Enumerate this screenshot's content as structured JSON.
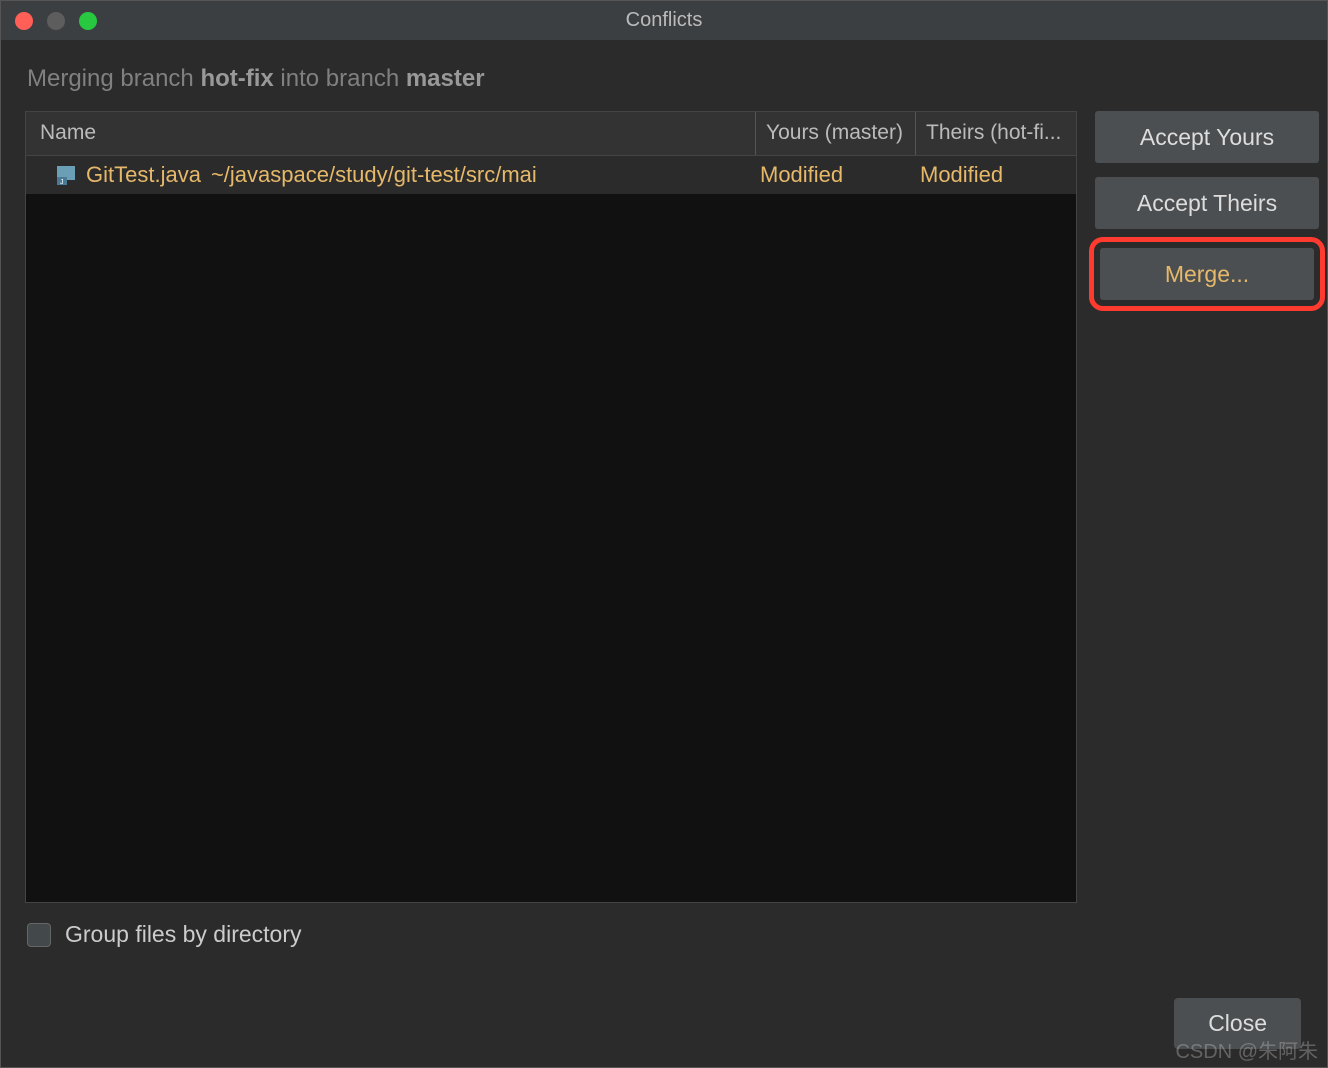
{
  "window": {
    "title": "Conflicts"
  },
  "merge_info": {
    "prefix": "Merging branch ",
    "source_branch": "hot-fix",
    "middle": " into branch ",
    "target_branch": "master"
  },
  "table": {
    "headers": {
      "name": "Name",
      "yours": "Yours (master)",
      "theirs": "Theirs (hot-fi..."
    },
    "rows": [
      {
        "file_name": "GitTest.java",
        "file_path": "~/javaspace/study/git-test/src/mai",
        "yours_status": "Modified",
        "theirs_status": "Modified"
      }
    ]
  },
  "buttons": {
    "accept_yours": "Accept Yours",
    "accept_theirs": "Accept Theirs",
    "merge": "Merge...",
    "close": "Close"
  },
  "checkbox": {
    "group_files": "Group files by directory"
  },
  "watermark": "CSDN @朱阿朱"
}
